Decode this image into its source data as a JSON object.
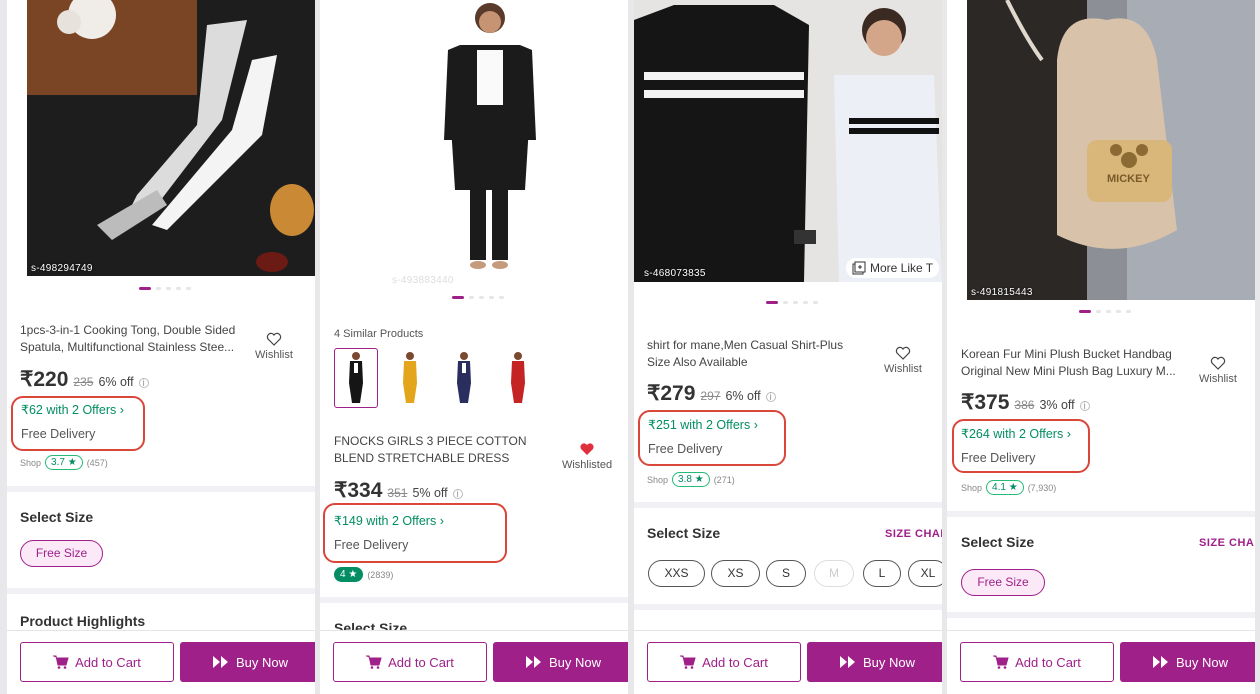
{
  "common": {
    "wishlist_label": "Wishlist",
    "wishlisted_label": "Wishlisted",
    "add_to_cart": "Add to Cart",
    "buy_now": "Buy Now",
    "select_size": "Select Size",
    "size_chart": "SIZE CHAI",
    "shop_label": "Shop",
    "free_delivery": "Free Delivery"
  },
  "panels": [
    {
      "sku": "s-498294749",
      "title": "1pcs-3-in-1 Cooking Tong, Double Sided Spatula, Multifunctional Stainless Stee...",
      "price": "₹220",
      "mrp": "235",
      "discount": "6% off",
      "offers": "₹62 with 2 Offers ›",
      "rating": "3.7 ★",
      "reviews": "(457)",
      "sizes": [
        "Free Size"
      ],
      "highlights_heading": "Product Highlights"
    },
    {
      "sku": "s-493883440",
      "similar_label": "4 Similar Products",
      "title": "FNOCKS GIRLS 3 PIECE COTTON BLEND STRETCHABLE DRESS",
      "price": "₹334",
      "mrp": "351",
      "discount": "5% off",
      "offers": "₹149 with 2 Offers ›",
      "rating": "4 ★",
      "reviews": "(2839)",
      "partial_heading": "Select Size"
    },
    {
      "sku": "s-468073835",
      "more_like": "More Like T",
      "title": "shirt for mane,Men Casual Shirt-Plus Size Also Available",
      "price": "₹279",
      "mrp": "297",
      "discount": "6% off",
      "offers": "₹251 with 2 Offers ›",
      "rating": "3.8 ★",
      "reviews": "(271)",
      "sizes": [
        "XXS",
        "XS",
        "S",
        "M",
        "L",
        "XL"
      ]
    },
    {
      "sku": "s-491815443",
      "bag_text": "MICKEY",
      "title": "Korean Fur Mini Plush Bucket Handbag Original New Mini Plush Bag Luxury  M...",
      "price": "₹375",
      "mrp": "386",
      "discount": "3% off",
      "offers": "₹264 with 2 Offers ›",
      "rating": "4.1 ★",
      "reviews": "(7,930)",
      "sizes": [
        "Free Size"
      ]
    }
  ],
  "colors": {
    "brand": "#9f2089",
    "offer_green": "#038d63",
    "highlight_ring": "#d9463a"
  }
}
